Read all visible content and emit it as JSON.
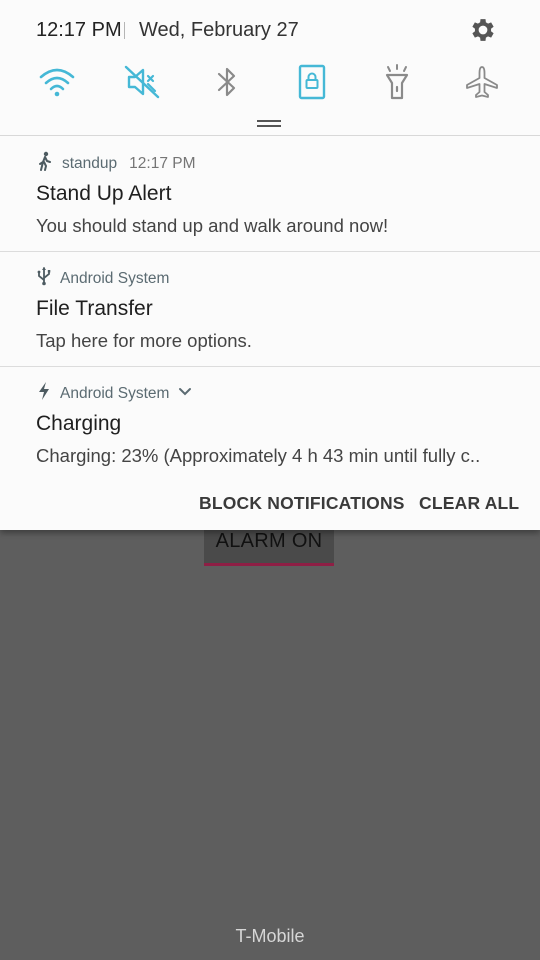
{
  "status": {
    "time": "12:17 PM",
    "date": "Wed, February 27"
  },
  "quick_settings": [
    {
      "name": "wifi",
      "active": true
    },
    {
      "name": "sound-muted",
      "active": true
    },
    {
      "name": "bluetooth",
      "active": false
    },
    {
      "name": "screen-lock",
      "active": true
    },
    {
      "name": "flashlight",
      "active": false
    },
    {
      "name": "airplane",
      "active": false
    }
  ],
  "notifications": [
    {
      "app": "standup",
      "time": "12:17 PM",
      "title": "Stand Up Alert",
      "text": "You should stand up and walk around now!",
      "icon": "walking-person-icon"
    },
    {
      "app": "Android System",
      "title": "File Transfer",
      "text": "Tap here for more options.",
      "icon": "usb-icon"
    },
    {
      "app": "Android System",
      "title": "Charging",
      "text": "Charging: 23% (Approximately 4 h 43 min until fully c..",
      "icon": "lightning-icon"
    }
  ],
  "actions": {
    "block": "BLOCK NOTIFICATIONS",
    "clear": "CLEAR ALL"
  },
  "background": {
    "alarm_button": "ALARM ON",
    "carrier": "T-Mobile"
  },
  "colors": {
    "accent": "#45b8d6",
    "inactive_icon": "#8a8a8a",
    "shade_bg": "#fbfbfb",
    "scrim": "#5e5e5e"
  }
}
